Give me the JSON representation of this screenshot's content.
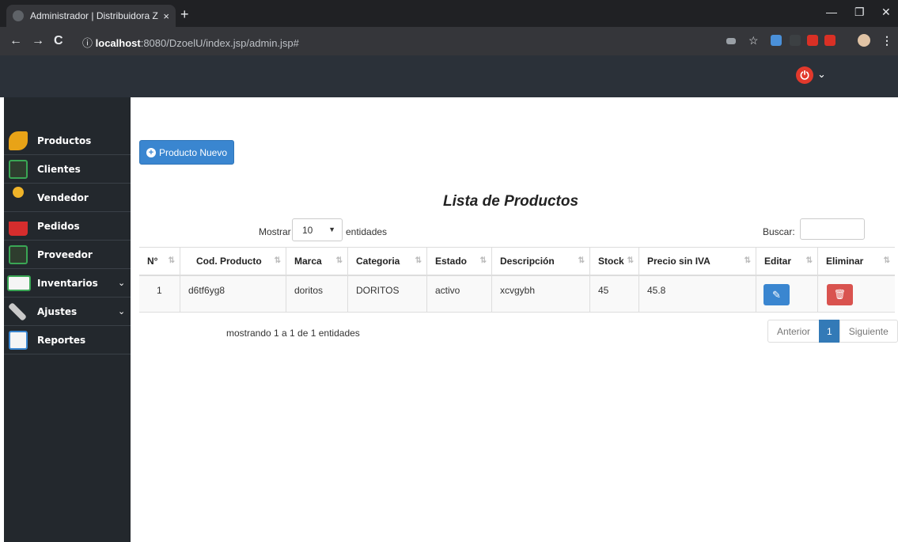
{
  "browser": {
    "tab_title": "Administrador | Distribuidora ZO",
    "tab_close": "×",
    "new_tab": "+",
    "url_info": "ⓘ",
    "url_host": "localhost",
    "url_path": ":8080/DzoelU/index.jsp/admin.jsp#",
    "window_controls": [
      "—",
      "❐",
      "✕"
    ]
  },
  "navbar": {
    "power_icon": "⏻",
    "user_chevron": "⌄"
  },
  "sidebar": {
    "items": [
      {
        "label": "Productos",
        "icon": "wheat-icon",
        "color": "#e8a317"
      },
      {
        "label": "Clientes",
        "icon": "client-icon",
        "color": "#3aa655"
      },
      {
        "label": "Vendedor",
        "icon": "network-user-icon",
        "color": "#f0b429"
      },
      {
        "label": "Pedidos",
        "icon": "basket-icon",
        "color": "#d62d2d"
      },
      {
        "label": "Proveedor",
        "icon": "supplier-icon",
        "color": "#3aa655"
      },
      {
        "label": "Inventarios",
        "icon": "inventory-icon",
        "color": "#f5f5f5",
        "chevron": "⌄"
      },
      {
        "label": "Ajustes",
        "icon": "tools-icon",
        "color": "#c9c9c9",
        "chevron": "⌄"
      },
      {
        "label": "Reportes",
        "icon": "chart-line-icon",
        "color": "#3a86d0"
      }
    ]
  },
  "main": {
    "new_button_label": "Producto Nuevo",
    "title": "Lista de Productos",
    "length_prefix": "Mostrar",
    "length_value": "10",
    "length_suffix": "entidades",
    "search_label": "Buscar:",
    "search_value": "",
    "table": {
      "headers": [
        "N°",
        "Cod. Producto",
        "Marca",
        "Categoria",
        "Estado",
        "Descripción",
        "Stock",
        "Precio sin IVA",
        "Editar",
        "Eliminar"
      ],
      "rows": [
        [
          "1",
          "d6tf6yg8",
          "doritos",
          "DORITOS",
          "activo",
          "xcvgybh",
          "45",
          "45.8"
        ]
      ]
    },
    "info": "mostrando 1 a 1 de 1 entidades",
    "pagination": {
      "prev": "Anterior",
      "current": "1",
      "next": "Siguiente"
    }
  },
  "colors": {
    "primary": "#3a86d0",
    "danger": "#d9534f",
    "sidebar": "#23282d",
    "navbar": "#2b3139"
  }
}
